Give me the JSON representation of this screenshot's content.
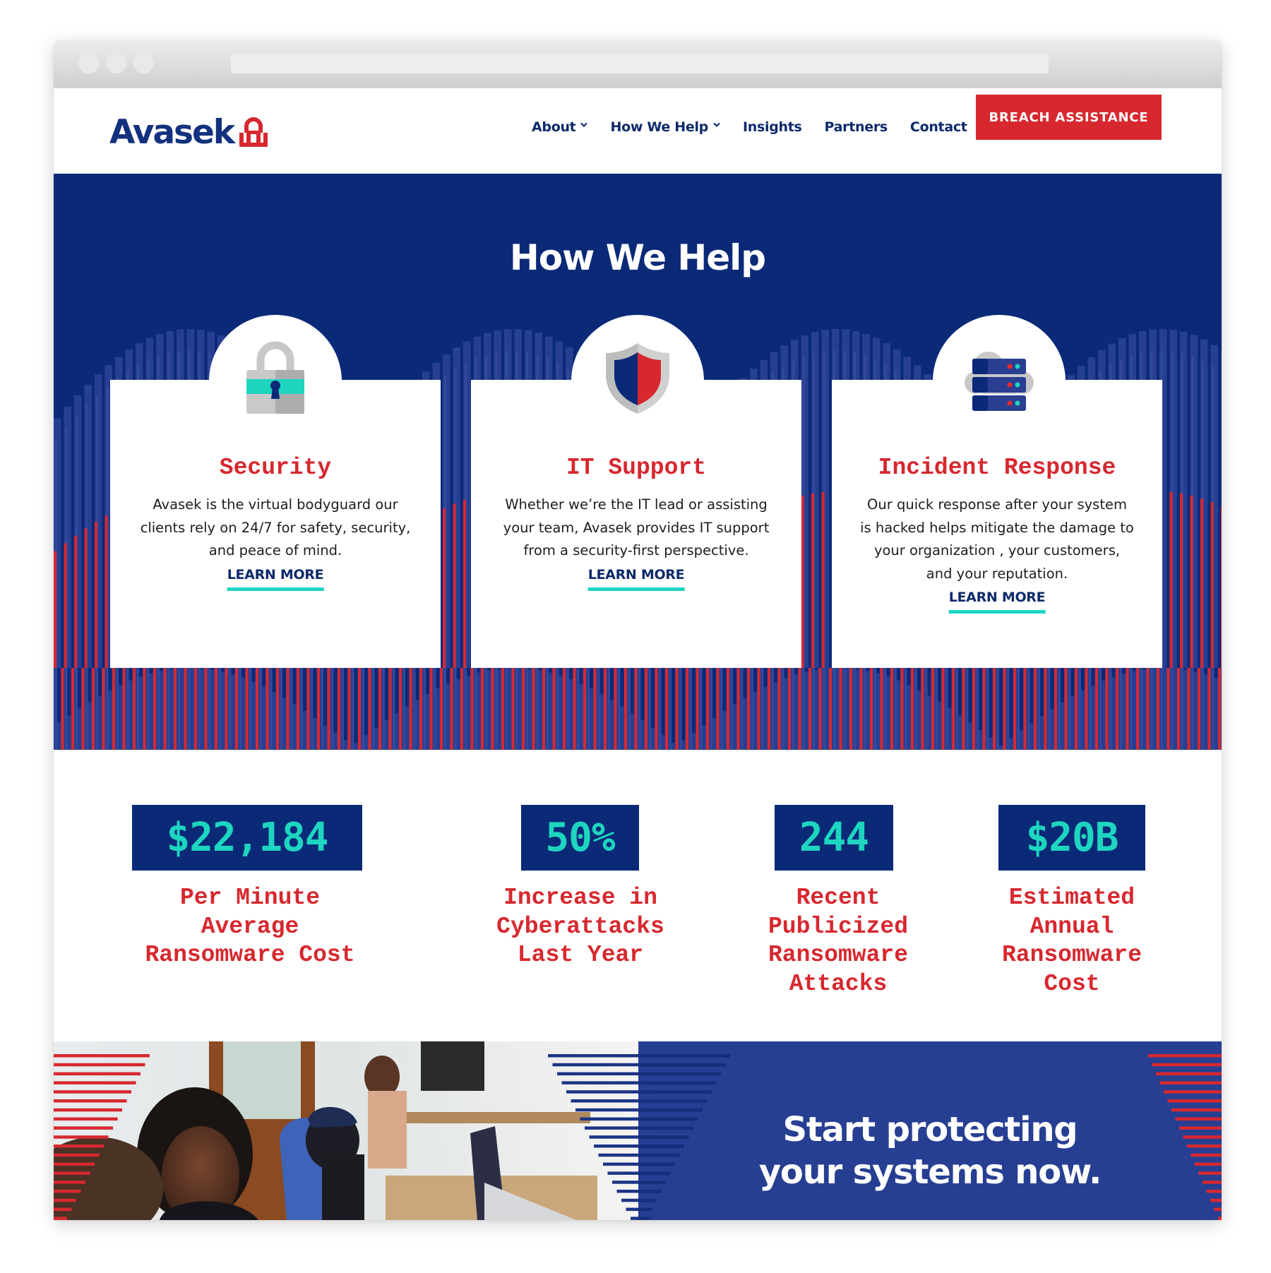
{
  "browser": {
    "window_dots": 3
  },
  "nav": {
    "logo_text": "Avasek",
    "logo_icon": "padlock-a-icon",
    "links": [
      {
        "label": "About",
        "has_dropdown": true
      },
      {
        "label": "How We Help",
        "has_dropdown": true
      },
      {
        "label": "Insights",
        "has_dropdown": false
      },
      {
        "label": "Partners",
        "has_dropdown": false
      },
      {
        "label": "Contact",
        "has_dropdown": false
      }
    ],
    "cta_label": "BREACH ASSISTANCE"
  },
  "hero": {
    "title": "How We Help",
    "cards": [
      {
        "icon": "padlock-icon",
        "title": "Security",
        "body": "Avasek is the virtual bodyguard our clients rely on 24/7 for safety, security, and peace of mind.",
        "link": "LEARN MORE"
      },
      {
        "icon": "shield-icon",
        "title": "IT Support",
        "body": "Whether we’re the IT lead or assisting your team, Avasek provides IT support from a security-first perspective.",
        "link": "LEARN MORE"
      },
      {
        "icon": "cloud-server-icon",
        "title": "Incident Response",
        "body": "Our quick response after your system is hacked helps mitigate the damage to your organization , your customers, and your reputation.",
        "link": "LEARN MORE"
      }
    ]
  },
  "stats": [
    {
      "value": "$22,184",
      "label": "Per Minute\nAverage\nRansomware Cost"
    },
    {
      "value": "50%",
      "label": "Increase in\nCyberattacks\nLast Year"
    },
    {
      "value": "244",
      "label": "Recent\nPublicized\nRansomware\nAttacks"
    },
    {
      "value": "$20B",
      "label": "Estimated\nAnnual\nRansomware\nCost"
    }
  ],
  "banner": {
    "headline": "Start protecting your systems now.",
    "headline_line1": "Start protecting",
    "headline_line2": "your systems now.",
    "photo": "team-working-at-laptops-photo"
  },
  "colors": {
    "navy": "#0a2a78",
    "mid_blue": "#273f92",
    "red": "#d7282f",
    "teal": "#1ed5bf",
    "nav_text": "#0e2a6b"
  }
}
